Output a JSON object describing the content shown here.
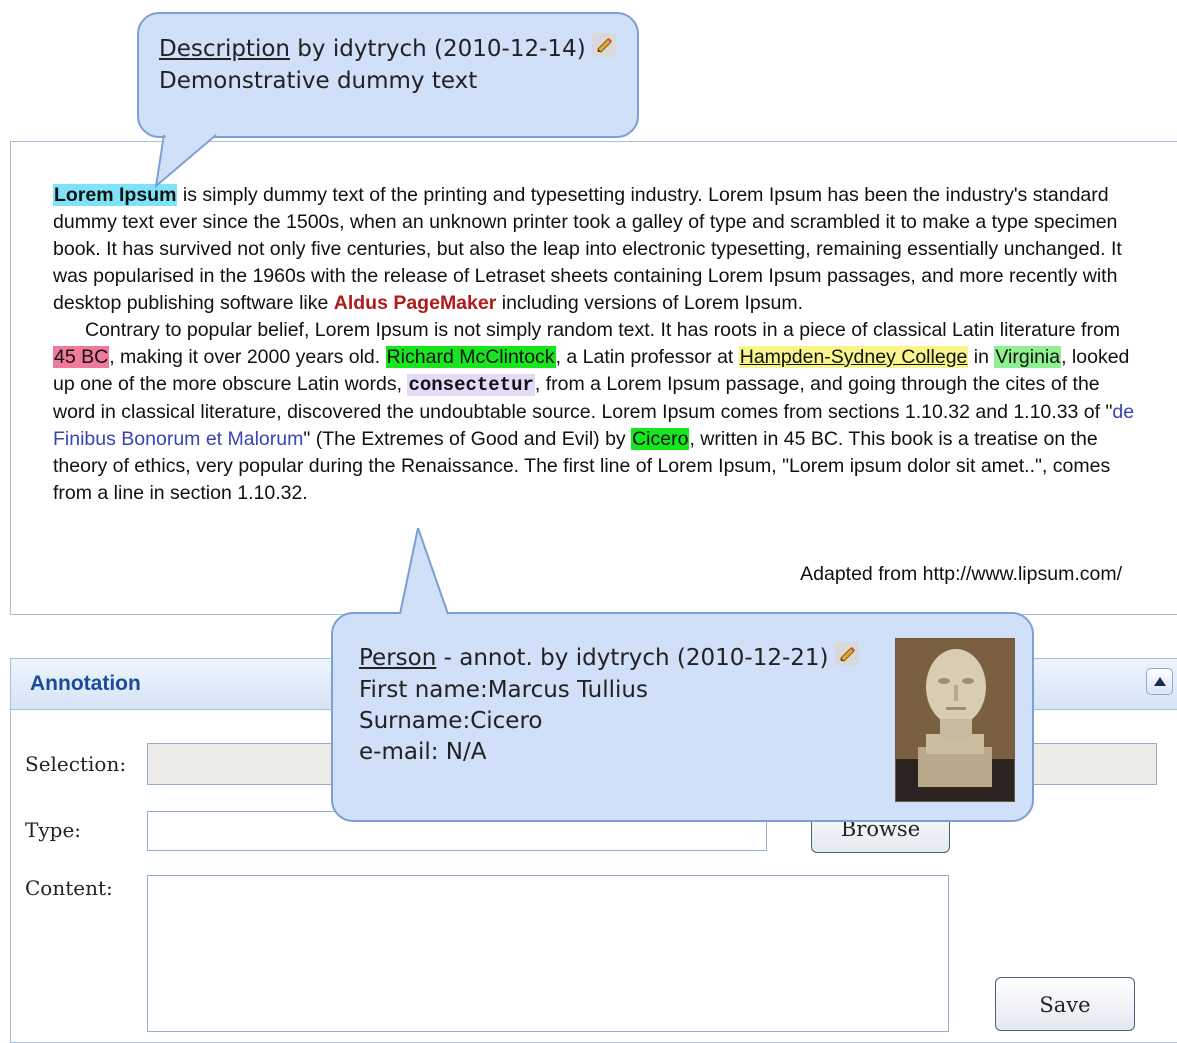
{
  "document": {
    "paragraph1": {
      "highlight_desc": "Lorem Ipsum",
      "text1": " is simply dummy text of the printing and typesetting industry. Lorem Ipsum has been the industry's standard dummy text ever since the 1500s, when an unknown printer took a galley of type and scrambled it to make a type specimen book. It has survived not only five centuries, but also the leap into electronic typesetting, remaining essentially unchanged. It was popularised in the 1960s with the release of Letraset sheets containing Lorem Ipsum passages, and more recently with desktop publishing software like ",
      "brand": "Aldus PageMaker",
      "text2": " including versions of Lorem Ipsum."
    },
    "paragraph2": {
      "t1": "Contrary to popular belief, Lorem Ipsum is not simply random text. It has roots in a piece of classical Latin literature from ",
      "date": "45 BC",
      "t2": ", making it over 2000 years old. ",
      "person1": "Richard McClintock",
      "t3": ", a Latin professor at ",
      "place": "Hampden-Sydney College",
      "t4": " in ",
      "location": "Virginia",
      "t5": ", looked up one of the more obscure Latin words, ",
      "term": "consectetur",
      "t6": ", from a Lorem Ipsum passage, and going through the cites of the word in classical literature, discovered the undoubtable source. Lorem Ipsum comes from sections 1.10.32 and 1.10.33 of \"",
      "link": "de Finibus Bonorum et Malorum",
      "t7": "\" (The Extremes of Good and Evil) by ",
      "person2": "Cicero",
      "t8": ", written in 45 BC. This book is a treatise on the theory of ethics, very popular during the Renaissance. The first line of Lorem Ipsum, \"Lorem ipsum dolor sit amet..\", comes from a line in section 1.10.32."
    },
    "source_note": "Adapted from http://www.lipsum.com/"
  },
  "description_bubble": {
    "type_label": "Description",
    "meta": " by idytrych (2010-12-14)",
    "text": "Demonstrative dummy text"
  },
  "person_bubble": {
    "type_label": "Person",
    "meta": " - annot. by idytrych (2010-12-21)",
    "first_name": "First name:Marcus Tullius",
    "surname": "Surname:Cicero",
    "email": "e-mail: N/A"
  },
  "annotation_panel": {
    "title": "Annotation",
    "selection_label": "Selection:",
    "type_label": "Type:",
    "content_label": "Content:",
    "browse_label": "Browse",
    "save_label": "Save"
  },
  "colors": {
    "description_highlight": "#7fe3f7",
    "date_highlight": "#f07a9a",
    "person_highlight": "#17e61e",
    "place_highlight": "#f8f58a",
    "location_highlight": "#8ef08e",
    "term_highlight": "#e4d9f7",
    "bubble_fill": "#cfe0f8",
    "panel_title": "#1b4b9a"
  }
}
